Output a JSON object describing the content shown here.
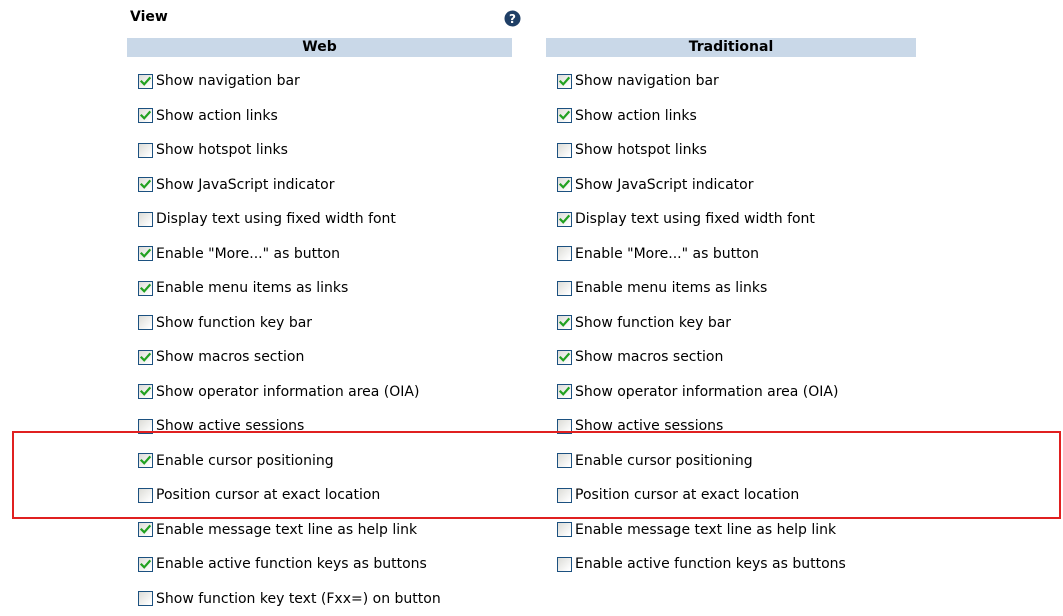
{
  "title": "View",
  "help_icon": "help-question-icon",
  "columns": [
    {
      "header": "Web",
      "items": [
        {
          "label": "Show navigation bar",
          "checked": true
        },
        {
          "label": "Show action links",
          "checked": true
        },
        {
          "label": "Show hotspot links",
          "checked": false
        },
        {
          "label": "Show JavaScript indicator",
          "checked": true
        },
        {
          "label": "Display text using fixed width font",
          "checked": false
        },
        {
          "label": "Enable \"More...\" as button",
          "checked": true
        },
        {
          "label": "Enable menu items as links",
          "checked": true
        },
        {
          "label": "Show function key bar",
          "checked": false
        },
        {
          "label": "Show macros section",
          "checked": true
        },
        {
          "label": "Show operator information area (OIA)",
          "checked": true
        },
        {
          "label": "Show active sessions",
          "checked": false
        },
        {
          "label": "Enable cursor positioning",
          "checked": true
        },
        {
          "label": "Position cursor at exact location",
          "checked": false
        },
        {
          "label": "Enable message text line as help link",
          "checked": true
        },
        {
          "label": "Enable active function keys as buttons",
          "checked": true
        },
        {
          "label": "Show function key text (Fxx=) on button",
          "checked": false
        }
      ]
    },
    {
      "header": "Traditional",
      "items": [
        {
          "label": "Show navigation bar",
          "checked": true
        },
        {
          "label": "Show action links",
          "checked": true
        },
        {
          "label": "Show hotspot links",
          "checked": false
        },
        {
          "label": "Show JavaScript indicator",
          "checked": true
        },
        {
          "label": "Display text using fixed width font",
          "checked": true
        },
        {
          "label": "Enable \"More...\" as button",
          "checked": false
        },
        {
          "label": "Enable menu items as links",
          "checked": false
        },
        {
          "label": "Show function key bar",
          "checked": true
        },
        {
          "label": "Show macros section",
          "checked": true
        },
        {
          "label": "Show operator information area (OIA)",
          "checked": true
        },
        {
          "label": "Show active sessions",
          "checked": false
        },
        {
          "label": "Enable cursor positioning",
          "checked": false
        },
        {
          "label": "Position cursor at exact location",
          "checked": false
        },
        {
          "label": "Enable message text line as help link",
          "checked": false
        },
        {
          "label": "Enable active function keys as buttons",
          "checked": false
        }
      ]
    }
  ],
  "colors": {
    "header_bg": "#c9d8e8",
    "checkmark": "#21a121",
    "checkbox_border": "#1c5180",
    "highlight": "#e02020",
    "help_icon_bg": "#1f3f66"
  }
}
